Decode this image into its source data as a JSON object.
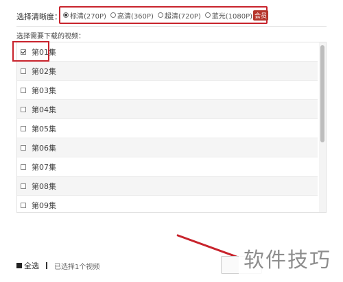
{
  "quality": {
    "label": "选择清晰度：",
    "options": [
      {
        "label": "标清(270P)",
        "selected": true
      },
      {
        "label": "高清(360P)",
        "selected": false
      },
      {
        "label": "超清(720P)",
        "selected": false
      },
      {
        "label": "蓝光(1080P)",
        "selected": false
      }
    ],
    "vip_badge": "会员"
  },
  "episode_list": {
    "title": "选择需要下载的视频：",
    "items": [
      {
        "label": "第01集",
        "checked": true
      },
      {
        "label": "第02集",
        "checked": false
      },
      {
        "label": "第03集",
        "checked": false
      },
      {
        "label": "第04集",
        "checked": false
      },
      {
        "label": "第05集",
        "checked": false
      },
      {
        "label": "第06集",
        "checked": false
      },
      {
        "label": "第07集",
        "checked": false
      },
      {
        "label": "第08集",
        "checked": false
      },
      {
        "label": "第09集",
        "checked": false
      }
    ]
  },
  "footer": {
    "select_all": "全选",
    "selected_count": "已选择1个视频"
  },
  "watermark": "软件技巧",
  "colors": {
    "highlight_red": "#c8232c",
    "vip_badge": "#b5352b",
    "row_alt": "#f5f5f5"
  }
}
